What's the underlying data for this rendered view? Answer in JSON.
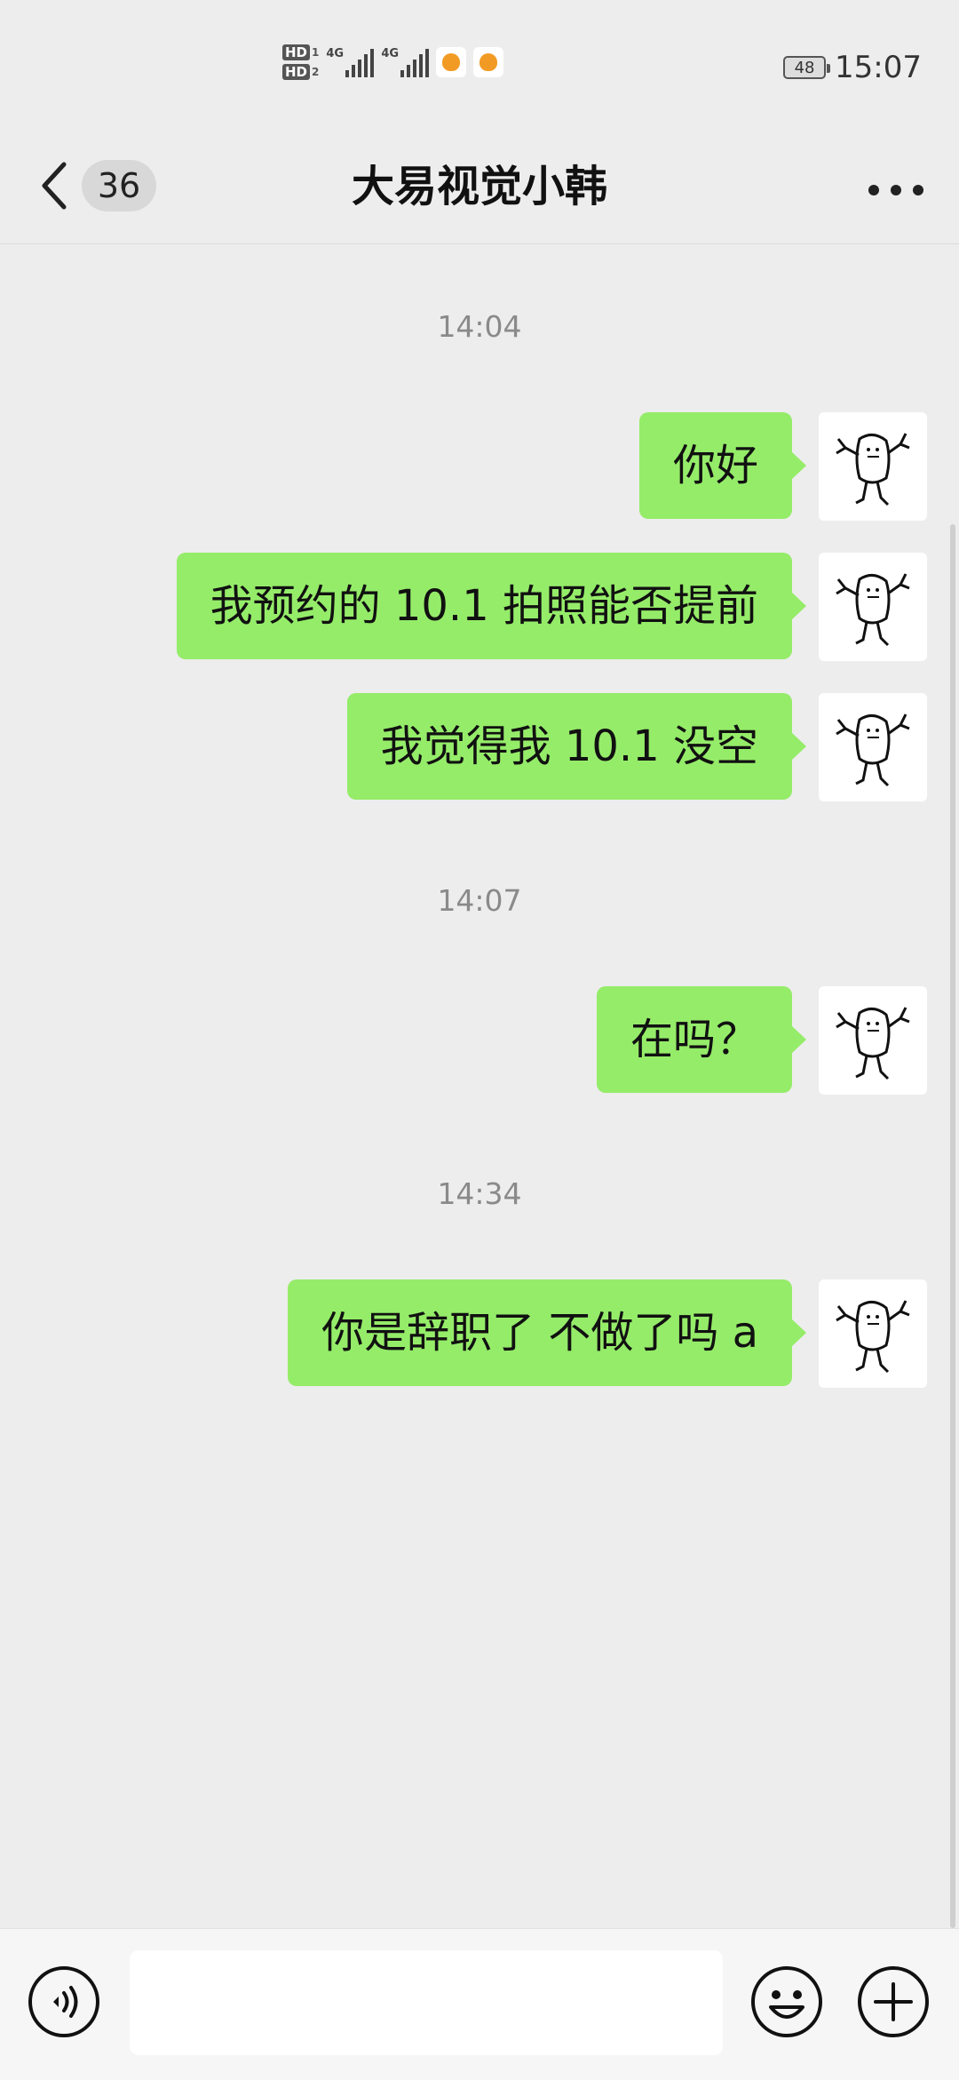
{
  "status_bar": {
    "hd1": "HD",
    "hd1_num": "1",
    "hd2": "HD",
    "hd2_num": "2",
    "sig1_label": "4G",
    "sig2_label": "4G",
    "battery": "48",
    "time": "15:07"
  },
  "header": {
    "back_icon": "chevron-left-icon",
    "unread_count": "36",
    "title": "大易视觉小韩",
    "more_icon": "more-dots-icon"
  },
  "chat": {
    "bubble_color": "#95ec69",
    "groups": [
      {
        "timestamp": "14:04",
        "messages": [
          "你好",
          "我预约的 10.1 拍照能否提前",
          "我觉得我 10.1 没空"
        ]
      },
      {
        "timestamp": "14:07",
        "messages": [
          "在吗？"
        ]
      },
      {
        "timestamp": "14:34",
        "messages": [
          "你是辞职了 不做了吗 a"
        ]
      }
    ]
  },
  "input_bar": {
    "voice_icon": "voice-icon",
    "text_value": "",
    "emoji_icon": "emoji-icon",
    "plus_icon": "plus-icon"
  }
}
